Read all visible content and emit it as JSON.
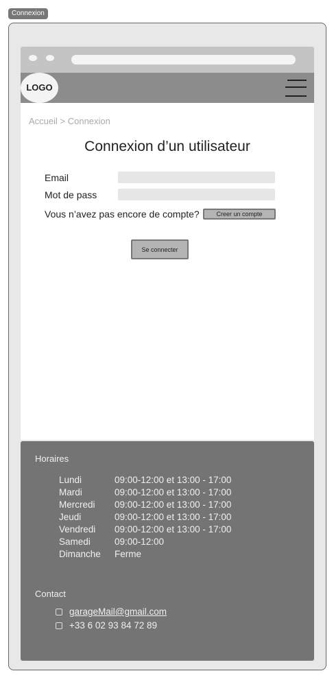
{
  "frame_label": "Connexion",
  "header": {
    "logo": "LOGO"
  },
  "breadcrumb": "Accueil > Connexion",
  "title": "Connexion d’un utilisateur",
  "form": {
    "email_label": "Email",
    "email_value": "",
    "password_label": "Mot de pass",
    "password_value": "",
    "no_account_text": "Vous n’avez pas encore de compte?",
    "create_account": "Creer un compte",
    "submit": "Se connecter"
  },
  "footer": {
    "hours_title": "Horaires",
    "hours": [
      {
        "day": "Lundi",
        "time": "09:00-12:00 et 13:00 - 17:00"
      },
      {
        "day": "Mardi",
        "time": "09:00-12:00 et 13:00 - 17:00"
      },
      {
        "day": "Mercredi",
        "time": "09:00-12:00 et 13:00 - 17:00"
      },
      {
        "day": "Jeudi",
        "time": "09:00-12:00 et 13:00 - 17:00"
      },
      {
        "day": "Vendredi",
        "time": "09:00-12:00 et 13:00 - 17:00"
      },
      {
        "day": "Samedi",
        "time": "09:00-12:00"
      },
      {
        "day": "Dimanche",
        "time": "Ferme"
      }
    ],
    "contact_title": "Contact",
    "email": "garageMail@gmail.com",
    "phone": "+33 6 02 93 84 72 89"
  }
}
